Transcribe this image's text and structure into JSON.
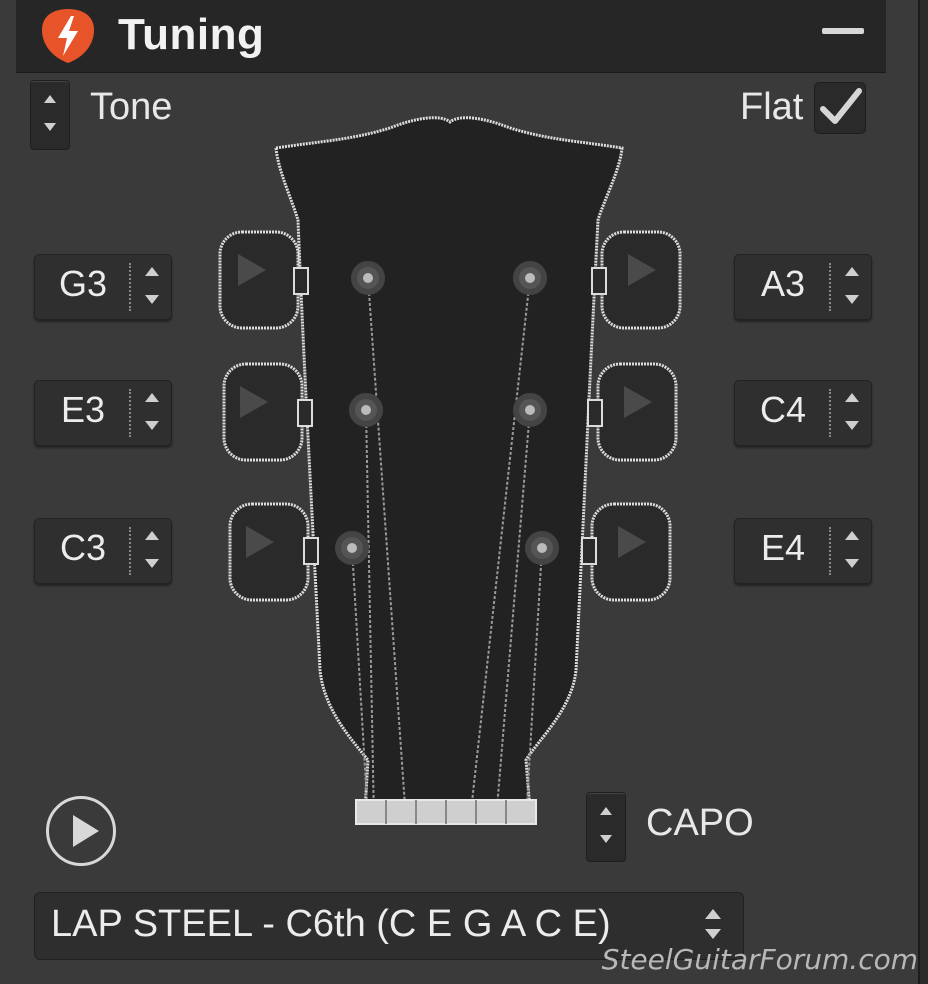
{
  "header": {
    "title": "Tuning",
    "logo_icon": "lightning-bolt-icon",
    "accent_color": "#e8542a"
  },
  "tone": {
    "label": "Tone"
  },
  "flat": {
    "label": "Flat",
    "checked": true
  },
  "strings_left": [
    {
      "note": "G3"
    },
    {
      "note": "E3"
    },
    {
      "note": "C3"
    }
  ],
  "strings_right": [
    {
      "note": "A3"
    },
    {
      "note": "C4"
    },
    {
      "note": "E4"
    }
  ],
  "capo": {
    "label": "CAPO"
  },
  "tuning_select": {
    "value": "LAP STEEL - C6th (C E G A C E)"
  },
  "watermark": "SteelGuitarForum.com"
}
